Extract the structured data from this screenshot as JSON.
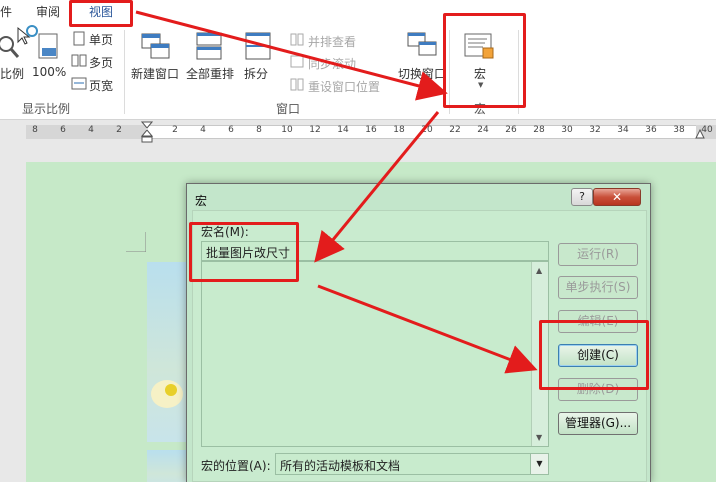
{
  "ribbon": {
    "tabs": [
      "件",
      "审阅",
      "视图"
    ],
    "active_tab": "视图",
    "zoom": {
      "ratio_label": "比例",
      "hundred_label": "100%",
      "single_page": "单页",
      "multi_page": "多页",
      "page_width": "页宽",
      "group_label": "显示比例"
    },
    "window": {
      "new_window": "新建窗口",
      "arrange_all": "全部重排",
      "split": "拆分",
      "side_by_side": "并排查看",
      "sync_scroll": "同步滚动",
      "reset_position": "重设窗口位置",
      "switch_window": "切换窗口",
      "group_label": "窗口"
    },
    "macro": {
      "button_label": "宏",
      "group_label": "宏"
    }
  },
  "ruler": {
    "ticks": [
      "8",
      "6",
      "4",
      "2",
      "2",
      "4",
      "6",
      "8",
      "10",
      "12",
      "14",
      "16",
      "18",
      "20",
      "22",
      "24",
      "26",
      "28",
      "30",
      "32",
      "34",
      "36",
      "38",
      "40"
    ]
  },
  "dialog": {
    "title": "宏",
    "help_btn": "?",
    "close_btn": "✕",
    "macro_name_label": "宏名(M):",
    "macro_name_value": "批量图片改尺寸",
    "buttons": {
      "run": "运行(R)",
      "step": "单步执行(S)",
      "edit": "编辑(E)",
      "create": "创建(C)",
      "delete": "删除(D)",
      "organizer": "管理器(G)..."
    },
    "location_label": "宏的位置(A):",
    "location_value": "所有的活动模板和文档"
  },
  "colors": {
    "annotation": "#e31c1c",
    "doc_bg": "#c6e9c8",
    "active_tab": "#2b579a"
  }
}
